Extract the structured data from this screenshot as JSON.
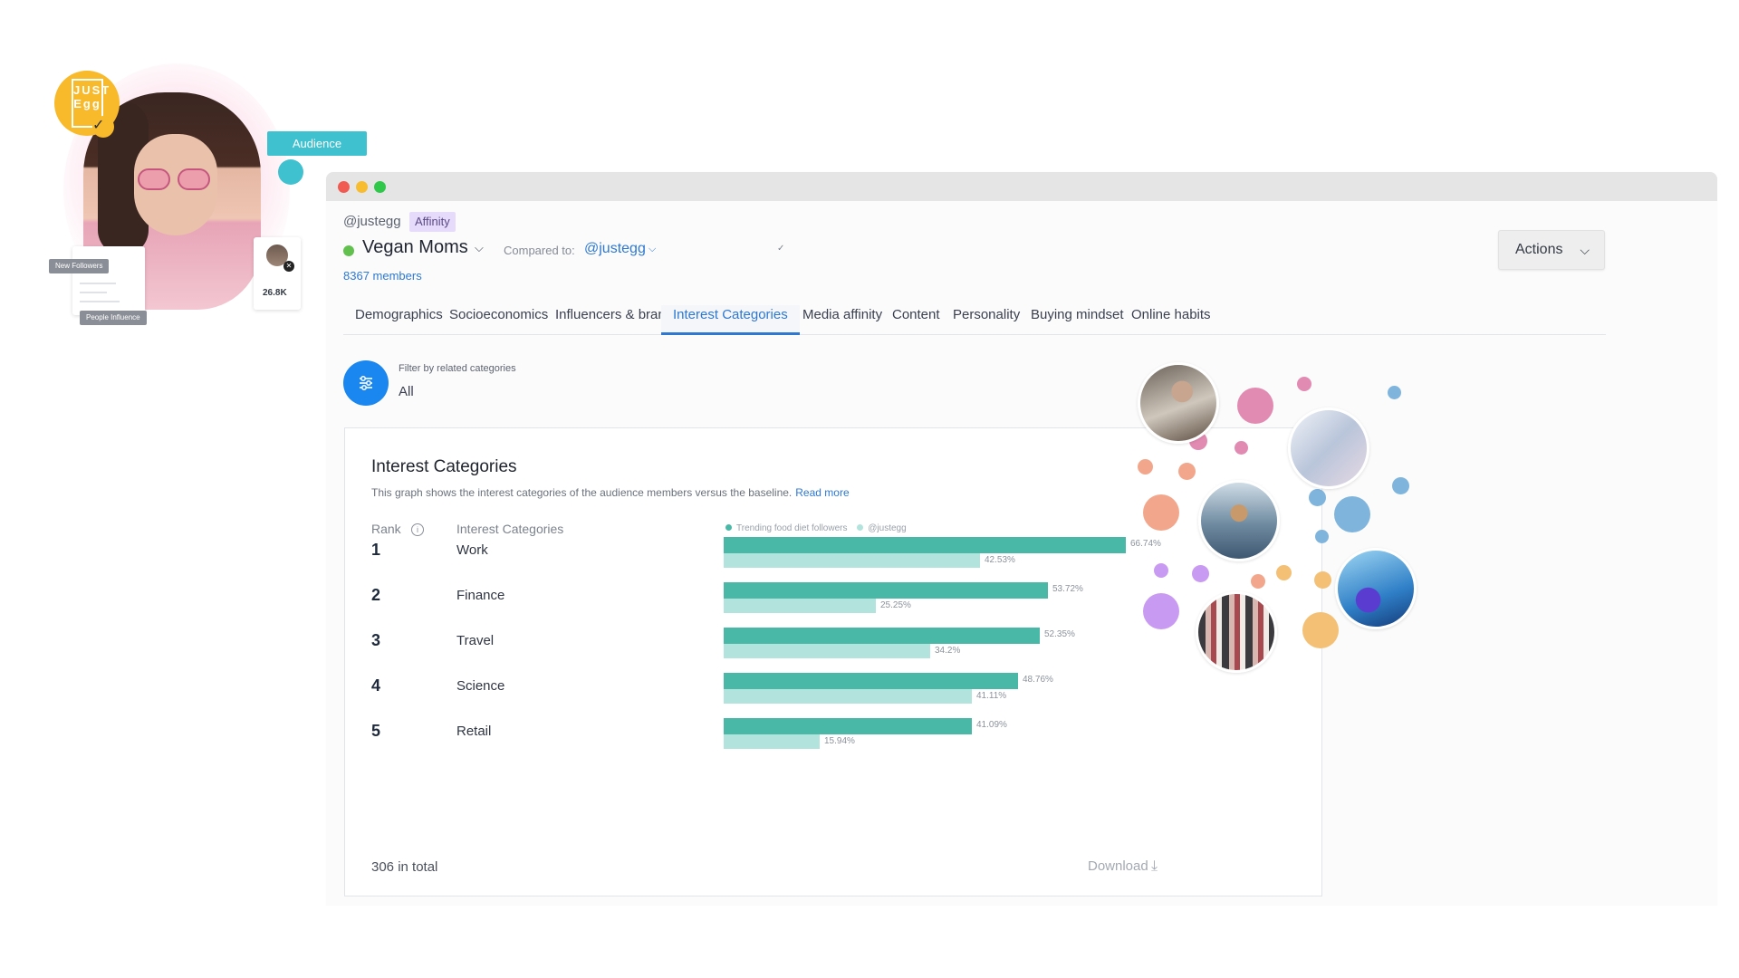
{
  "hero": {
    "logo_text": "JUST Egg",
    "audience_badge": "Audience",
    "new_followers_tag": "New Followers",
    "people_influence_tag": "People Influence",
    "follower_count": "26.8K"
  },
  "header": {
    "handle": "@justegg",
    "badge": "Affinity",
    "audience_name": "Vegan Moms",
    "compared_label": "Compared to:",
    "compared_value": "@justegg",
    "members": "8367 members",
    "actions_label": "Actions"
  },
  "tabs": [
    {
      "label": "Demographics",
      "active": false
    },
    {
      "label": "Socioeconomics",
      "active": false
    },
    {
      "label": "Influencers & brands",
      "active": false
    },
    {
      "label": "Interest Categories",
      "active": true
    },
    {
      "label": "Media affinity",
      "active": false
    },
    {
      "label": "Content",
      "active": false
    },
    {
      "label": "Personality",
      "active": false
    },
    {
      "label": "Buying mindset",
      "active": false
    },
    {
      "label": "Online habits",
      "active": false
    }
  ],
  "filter": {
    "label": "Filter by related categories",
    "value": "All"
  },
  "card": {
    "title": "Interest Categories",
    "description": "This graph shows the interest categories of the audience members versus the baseline.",
    "read_more": "Read more",
    "col_rank": "Rank",
    "col_category": "Interest Categories",
    "legend_primary": "Trending food diet followers",
    "legend_base": "@justegg",
    "total": "306 in total",
    "download": "Download"
  },
  "colors": {
    "accent": "#2e78d2",
    "primary_bar": "#4ab8a6",
    "baseline_bar": "#b2e3dc",
    "status_dot": "#62c04f",
    "affinity_badge": "#e7dbfc"
  },
  "chart_data": {
    "type": "bar",
    "orientation": "horizontal",
    "title": "Interest Categories",
    "categories": [
      "Work",
      "Finance",
      "Travel",
      "Science",
      "Retail"
    ],
    "ranks": [
      "1",
      "2",
      "3",
      "4",
      "5"
    ],
    "series": [
      {
        "name": "Trending food diet followers",
        "values": [
          66.74,
          53.72,
          52.35,
          48.76,
          41.09
        ],
        "labels": [
          "66.74%",
          "53.72%",
          "52.35%",
          "48.76%",
          "41.09%"
        ]
      },
      {
        "name": "@justegg",
        "values": [
          42.53,
          25.25,
          34.2,
          41.11,
          15.94
        ],
        "labels": [
          "42.53%",
          "25.25%",
          "34.2%",
          "41.11%",
          "15.94%"
        ]
      }
    ],
    "xlim": [
      0,
      100
    ],
    "grid": false,
    "legend_position": "top"
  }
}
